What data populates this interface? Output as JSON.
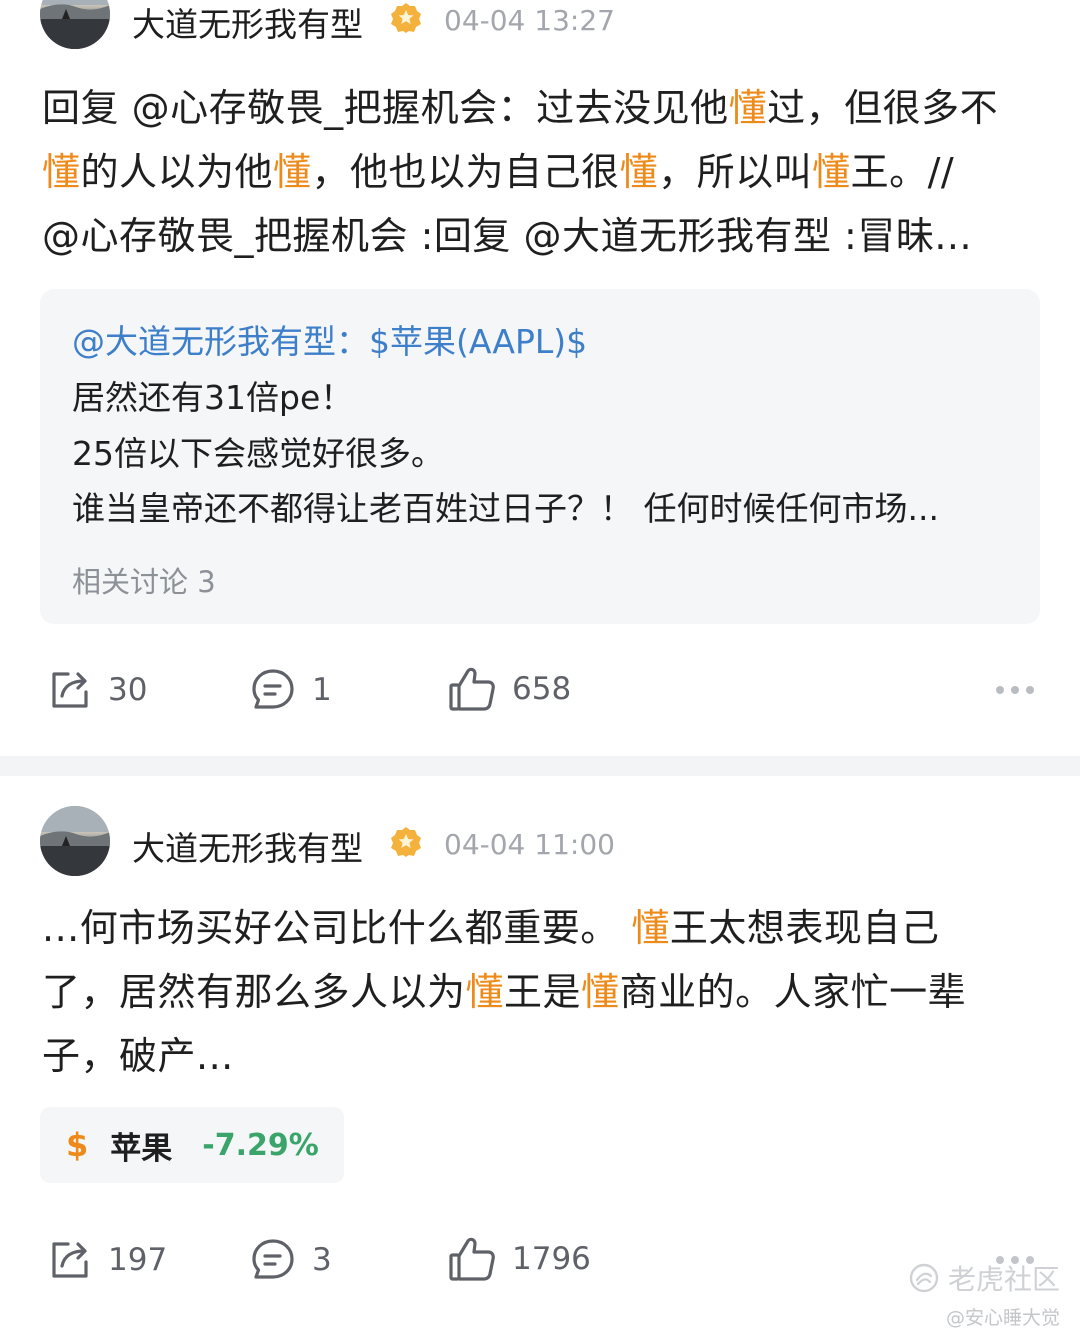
{
  "posts": [
    {
      "author": "大道无形我有型",
      "time": "04-04 13:27",
      "lines": [
        [
          "回复 @心存敬畏_把握机会：过去没见他",
          {
            "hl": "懂"
          },
          "过，但很多不"
        ],
        [
          {
            "hl": "懂"
          },
          "的人以为他",
          {
            "hl": "懂"
          },
          "，他也以为自己很",
          {
            "hl": "懂"
          },
          "，所以叫",
          {
            "hl": "懂"
          },
          "王。//"
        ],
        [
          "@心存敬畏_把握机会 :回复 @大道无形我有型 :冒昧..."
        ]
      ],
      "quote": {
        "head": "@大道无形我有型：$苹果(AAPL)$",
        "lines": [
          "居然还有31倍pe！",
          "25倍以下会感觉好很多。",
          "谁当皇帝还不都得让老百姓过日子？！ 任何时候任何市场..."
        ],
        "related": "相关讨论 3"
      },
      "shares": "30",
      "comments": "1",
      "likes": "658"
    },
    {
      "author": "大道无形我有型",
      "time": "04-04 11:00",
      "lines": [
        [
          "...何市场买好公司比什么都重要。 ",
          {
            "hl": "懂"
          },
          "王太想表现自己"
        ],
        [
          "了，居然有那么多人以为",
          {
            "hl": "懂"
          },
          "王是",
          {
            "hl": "懂"
          },
          "商业的。人家忙一辈"
        ],
        [
          "子，破产..."
        ]
      ],
      "stock": {
        "symbol": "$",
        "name": "苹果",
        "change": "-7.29%"
      },
      "shares": "197",
      "comments": "3",
      "likes": "1796"
    }
  ],
  "watermark": {
    "logo": "老虎社区",
    "user": "@安心睡大觉"
  },
  "colors": {
    "highlight": "#ed8a19",
    "link": "#3d7fc9",
    "down": "#3aa46a"
  },
  "icons": [
    "share-icon",
    "comment-icon",
    "like-icon",
    "more-icon",
    "verified-badge-icon"
  ]
}
